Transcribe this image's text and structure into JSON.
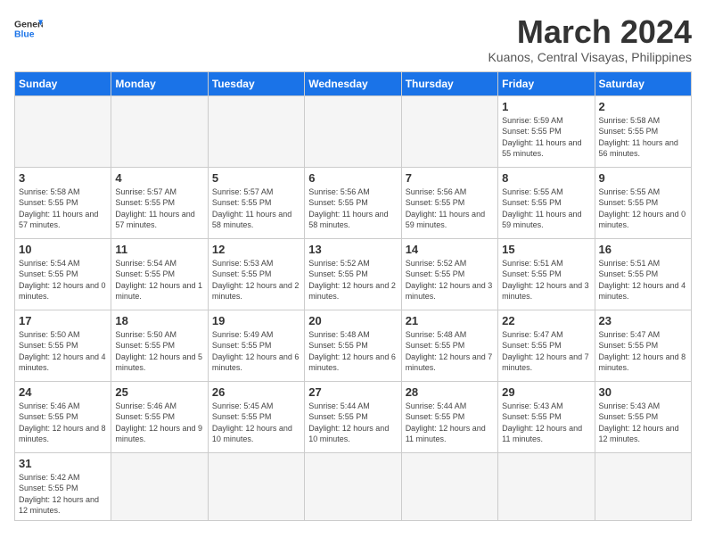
{
  "logo": {
    "general": "General",
    "blue": "Blue"
  },
  "title": "March 2024",
  "subtitle": "Kuanos, Central Visayas, Philippines",
  "days_of_week": [
    "Sunday",
    "Monday",
    "Tuesday",
    "Wednesday",
    "Thursday",
    "Friday",
    "Saturday"
  ],
  "weeks": [
    [
      {
        "day": "",
        "empty": true
      },
      {
        "day": "",
        "empty": true
      },
      {
        "day": "",
        "empty": true
      },
      {
        "day": "",
        "empty": true
      },
      {
        "day": "",
        "empty": true
      },
      {
        "day": "1",
        "sunrise": "5:59 AM",
        "sunset": "5:55 PM",
        "daylight": "11 hours and 55 minutes."
      },
      {
        "day": "2",
        "sunrise": "5:58 AM",
        "sunset": "5:55 PM",
        "daylight": "11 hours and 56 minutes."
      }
    ],
    [
      {
        "day": "3",
        "sunrise": "5:58 AM",
        "sunset": "5:55 PM",
        "daylight": "11 hours and 57 minutes."
      },
      {
        "day": "4",
        "sunrise": "5:57 AM",
        "sunset": "5:55 PM",
        "daylight": "11 hours and 57 minutes."
      },
      {
        "day": "5",
        "sunrise": "5:57 AM",
        "sunset": "5:55 PM",
        "daylight": "11 hours and 58 minutes."
      },
      {
        "day": "6",
        "sunrise": "5:56 AM",
        "sunset": "5:55 PM",
        "daylight": "11 hours and 58 minutes."
      },
      {
        "day": "7",
        "sunrise": "5:56 AM",
        "sunset": "5:55 PM",
        "daylight": "11 hours and 59 minutes."
      },
      {
        "day": "8",
        "sunrise": "5:55 AM",
        "sunset": "5:55 PM",
        "daylight": "11 hours and 59 minutes."
      },
      {
        "day": "9",
        "sunrise": "5:55 AM",
        "sunset": "5:55 PM",
        "daylight": "12 hours and 0 minutes."
      }
    ],
    [
      {
        "day": "10",
        "sunrise": "5:54 AM",
        "sunset": "5:55 PM",
        "daylight": "12 hours and 0 minutes."
      },
      {
        "day": "11",
        "sunrise": "5:54 AM",
        "sunset": "5:55 PM",
        "daylight": "12 hours and 1 minute."
      },
      {
        "day": "12",
        "sunrise": "5:53 AM",
        "sunset": "5:55 PM",
        "daylight": "12 hours and 2 minutes."
      },
      {
        "day": "13",
        "sunrise": "5:52 AM",
        "sunset": "5:55 PM",
        "daylight": "12 hours and 2 minutes."
      },
      {
        "day": "14",
        "sunrise": "5:52 AM",
        "sunset": "5:55 PM",
        "daylight": "12 hours and 3 minutes."
      },
      {
        "day": "15",
        "sunrise": "5:51 AM",
        "sunset": "5:55 PM",
        "daylight": "12 hours and 3 minutes."
      },
      {
        "day": "16",
        "sunrise": "5:51 AM",
        "sunset": "5:55 PM",
        "daylight": "12 hours and 4 minutes."
      }
    ],
    [
      {
        "day": "17",
        "sunrise": "5:50 AM",
        "sunset": "5:55 PM",
        "daylight": "12 hours and 4 minutes."
      },
      {
        "day": "18",
        "sunrise": "5:50 AM",
        "sunset": "5:55 PM",
        "daylight": "12 hours and 5 minutes."
      },
      {
        "day": "19",
        "sunrise": "5:49 AM",
        "sunset": "5:55 PM",
        "daylight": "12 hours and 6 minutes."
      },
      {
        "day": "20",
        "sunrise": "5:48 AM",
        "sunset": "5:55 PM",
        "daylight": "12 hours and 6 minutes."
      },
      {
        "day": "21",
        "sunrise": "5:48 AM",
        "sunset": "5:55 PM",
        "daylight": "12 hours and 7 minutes."
      },
      {
        "day": "22",
        "sunrise": "5:47 AM",
        "sunset": "5:55 PM",
        "daylight": "12 hours and 7 minutes."
      },
      {
        "day": "23",
        "sunrise": "5:47 AM",
        "sunset": "5:55 PM",
        "daylight": "12 hours and 8 minutes."
      }
    ],
    [
      {
        "day": "24",
        "sunrise": "5:46 AM",
        "sunset": "5:55 PM",
        "daylight": "12 hours and 8 minutes."
      },
      {
        "day": "25",
        "sunrise": "5:46 AM",
        "sunset": "5:55 PM",
        "daylight": "12 hours and 9 minutes."
      },
      {
        "day": "26",
        "sunrise": "5:45 AM",
        "sunset": "5:55 PM",
        "daylight": "12 hours and 10 minutes."
      },
      {
        "day": "27",
        "sunrise": "5:44 AM",
        "sunset": "5:55 PM",
        "daylight": "12 hours and 10 minutes."
      },
      {
        "day": "28",
        "sunrise": "5:44 AM",
        "sunset": "5:55 PM",
        "daylight": "12 hours and 11 minutes."
      },
      {
        "day": "29",
        "sunrise": "5:43 AM",
        "sunset": "5:55 PM",
        "daylight": "12 hours and 11 minutes."
      },
      {
        "day": "30",
        "sunrise": "5:43 AM",
        "sunset": "5:55 PM",
        "daylight": "12 hours and 12 minutes."
      }
    ],
    [
      {
        "day": "31",
        "sunrise": "5:42 AM",
        "sunset": "5:55 PM",
        "daylight": "12 hours and 12 minutes."
      },
      {
        "day": "",
        "empty": true
      },
      {
        "day": "",
        "empty": true
      },
      {
        "day": "",
        "empty": true
      },
      {
        "day": "",
        "empty": true
      },
      {
        "day": "",
        "empty": true
      },
      {
        "day": "",
        "empty": true
      }
    ]
  ]
}
